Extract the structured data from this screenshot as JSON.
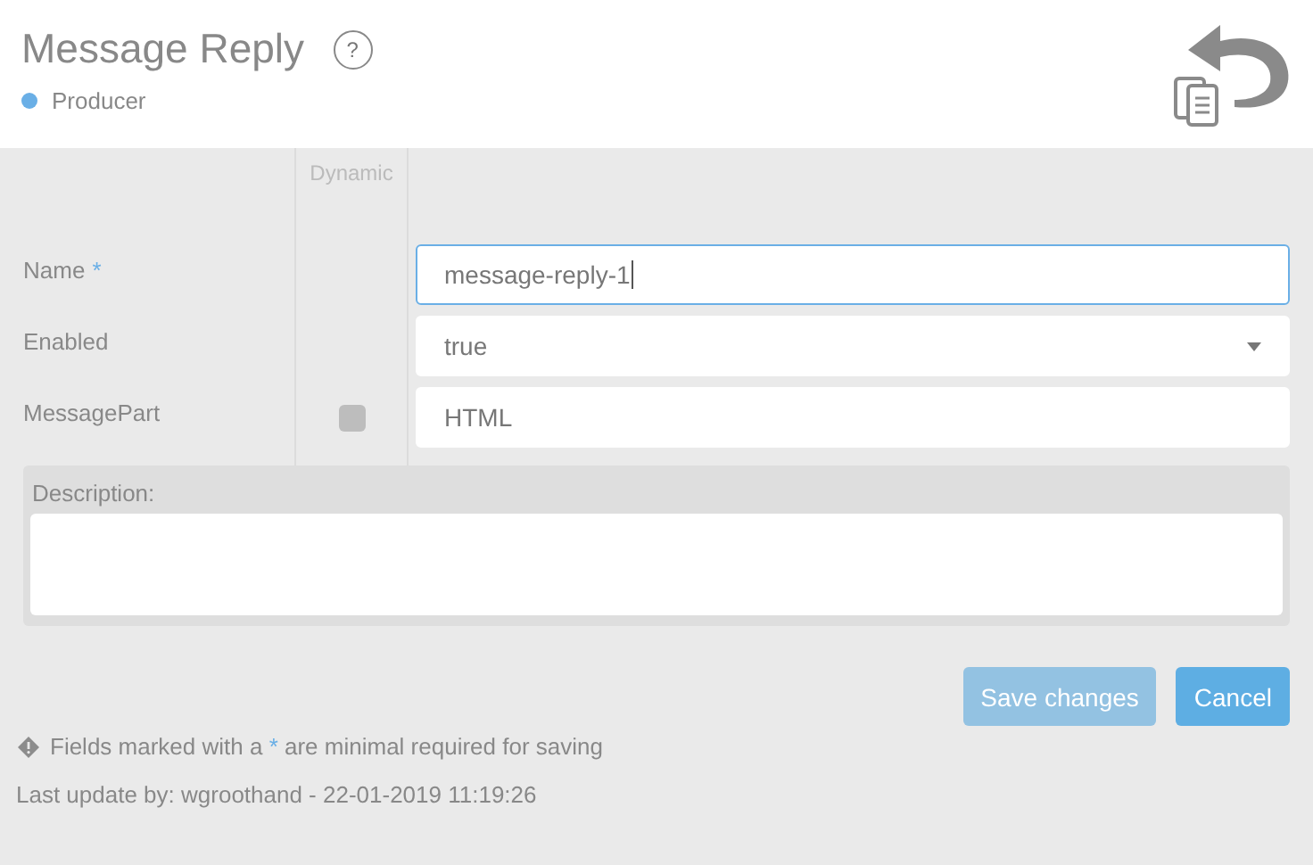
{
  "header": {
    "title": "Message Reply",
    "help": "?",
    "role": {
      "label": "Producer",
      "color": "#6aafe6"
    }
  },
  "form": {
    "dynamic_heading": "Dynamic",
    "fields": [
      {
        "label": "Name",
        "required_mark": "*",
        "kind": "input",
        "value": "message-reply-1",
        "focused": true
      },
      {
        "label": "Enabled",
        "kind": "select",
        "value": "true",
        "focused": false
      },
      {
        "label": "MessagePart",
        "kind": "input",
        "value": "HTML",
        "focused": false,
        "dynamic": {
          "checked": false
        }
      }
    ],
    "description": {
      "label": "Description:"
    }
  },
  "buttons": [
    {
      "label": "Save changes",
      "kind": "primary",
      "disabled": true
    },
    {
      "label": "Cancel",
      "kind": "primary",
      "disabled": false
    }
  ],
  "note": {
    "before": "Fields marked with a ",
    "mark": "*",
    "after": " are minimal required for saving"
  },
  "last_update": "Last update by: wgroothand - 22-01-2019 11:19:26"
}
